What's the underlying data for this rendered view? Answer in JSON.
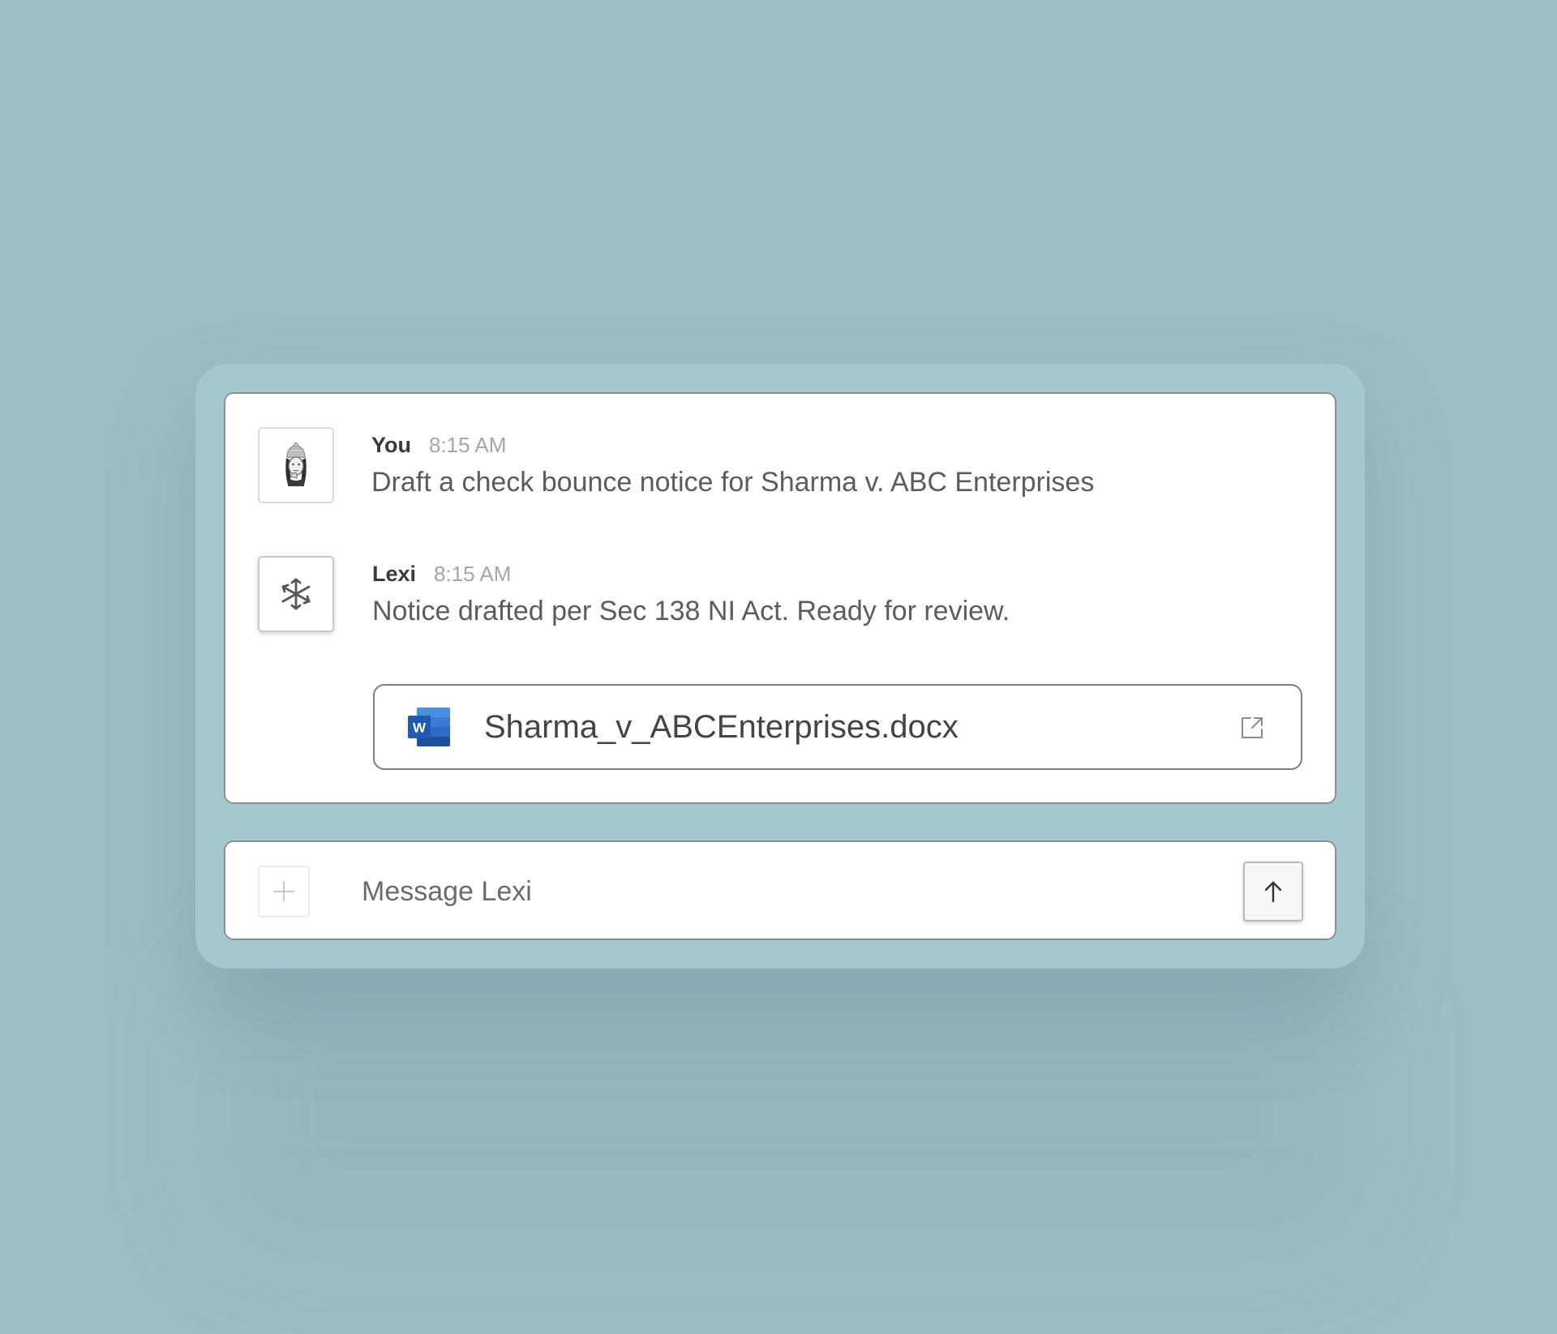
{
  "conversation": {
    "messages": [
      {
        "author": "You",
        "time": "8:15 AM",
        "text": "Draft a check bounce notice for Sharma v. ABC Enterprises",
        "avatar_icon": "user-avatar-icon"
      },
      {
        "author": "Lexi",
        "time": "8:15 AM",
        "text": "Notice drafted per Sec 138 NI Act. Ready for review.",
        "avatar_icon": "lexi-asterisk-icon"
      }
    ],
    "attachment": {
      "file_name": "Sharma_v_ABCEnterprises.docx",
      "file_icon": "word-file-icon",
      "open_icon": "open-external-icon",
      "icon_letter": "W"
    }
  },
  "composer": {
    "placeholder": "Message Lexi",
    "value": "",
    "add_icon": "plus-icon",
    "send_icon": "arrow-up-icon"
  },
  "colors": {
    "background": "#9cbec5",
    "panel": "#a5c7ce",
    "card": "#ffffff",
    "word_blue": "#2b6cc4"
  }
}
